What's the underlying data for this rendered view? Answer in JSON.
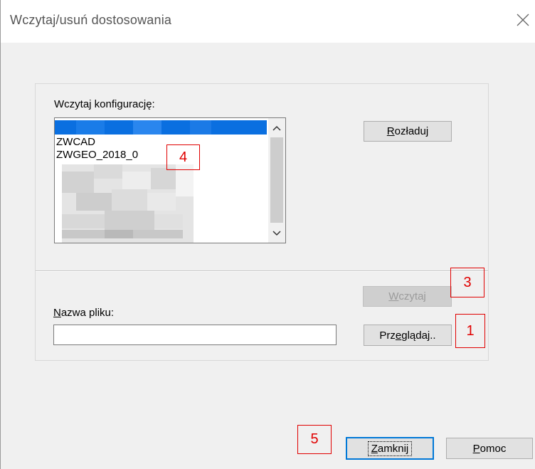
{
  "window": {
    "title": "Wczytaj/usuń dostosowania",
    "close_icon": "close-icon"
  },
  "load_config": {
    "label": "Wczytaj konfigurację:",
    "items": [
      "ZWCAD",
      "ZWGEO_2018_0"
    ]
  },
  "buttons": {
    "unload": {
      "pre": "",
      "accel": "R",
      "post": "ozładuj"
    },
    "load": {
      "pre": "",
      "accel": "W",
      "post": "czytaj"
    },
    "browse": {
      "pre": "Prz",
      "accel": "e",
      "post": "glądaj.."
    },
    "close": {
      "pre": "",
      "accel": "Z",
      "post": "amknij"
    },
    "help": {
      "pre": "",
      "accel": "P",
      "post": "omoc"
    }
  },
  "filename": {
    "label_accel": "N",
    "label_rest": "azwa pliku:",
    "value": ""
  },
  "annotations": [
    "1",
    "3",
    "4",
    "5"
  ],
  "colors": {
    "selection": "#0a6fe0",
    "annotation": "#e00000",
    "focus_border": "#0078d7"
  }
}
